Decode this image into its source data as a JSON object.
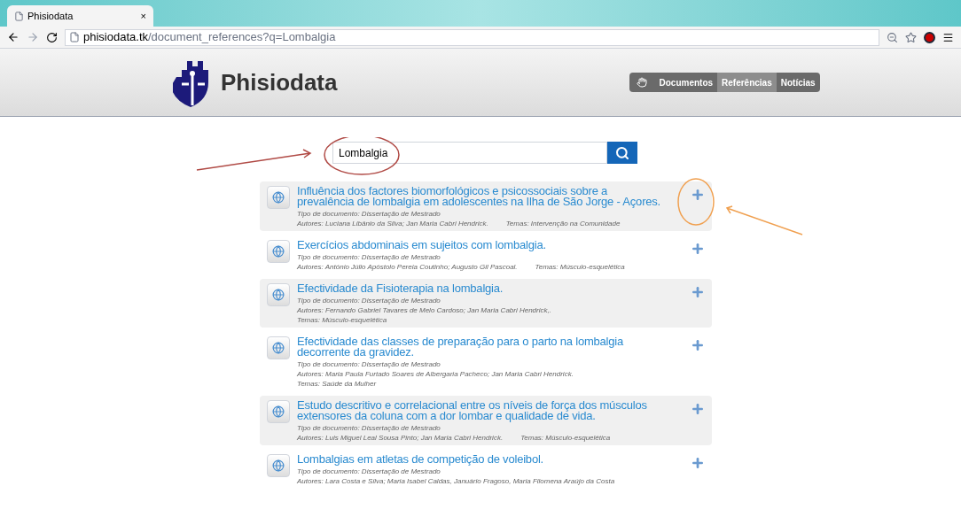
{
  "browser": {
    "tab_title": "Phisiodata",
    "tab_close": "×",
    "url_host": "phisiodata.tk",
    "url_path": "/document_references?q=Lombalgia"
  },
  "site": {
    "name": "Phisiodata",
    "nav": [
      {
        "label": "Documentos",
        "selected": false
      },
      {
        "label": "Referências",
        "selected": true
      },
      {
        "label": "Notícias",
        "selected": false
      }
    ]
  },
  "search": {
    "value": "Lombalgia"
  },
  "results": [
    {
      "title": "Influência dos factores biomorfológicos e psicossociais sobre a prevalência de lombalgia em adolescentes na Ilha de São Jorge - Açores.",
      "meta_lines": [
        [
          "Tipo de documento: Dissertação de Mestrado"
        ],
        [
          "Autores: Luciana Libânio da Silva; Jan Maria Cabri Hendrick.",
          "Temas: Intervenção na Comunidade"
        ]
      ]
    },
    {
      "title": "Exercícios abdominais em sujeitos com lombalgia.",
      "meta_lines": [
        [
          "Tipo de documento: Dissertação de Mestrado"
        ],
        [
          "Autores: António Júlio Apóstolo Pereia Coutinho; Augusto Gil Pascoal.",
          "Temas: Músculo-esquelética"
        ]
      ]
    },
    {
      "title": "Efectividade da Fisioterapia na lombalgia.",
      "meta_lines": [
        [
          "Tipo de documento: Dissertação de Mestrado"
        ],
        [
          "Autores: Fernando Gabriel Tavares de Melo Cardoso; Jan Maria Cabri Hendrick,."
        ],
        [
          "Temas: Músculo-esquelética"
        ]
      ]
    },
    {
      "title": "Efectividade das classes de preparação para o parto na lombalgia decorrente da gravidez.",
      "meta_lines": [
        [
          "Tipo de documento: Dissertação de Mestrado"
        ],
        [
          "Autores: Maria Paula Furtado Soares de Albergaria Pacheco; Jan Maria Cabri Hendrick."
        ],
        [
          "Temas: Saúde da Mulher"
        ]
      ]
    },
    {
      "title": "Estudo descritivo e correlacional entre os níveis de força dos músculos extensores da coluna com a dor lombar e qualidade de vida.",
      "meta_lines": [
        [
          "Tipo de documento: Dissertação de Mestrado"
        ],
        [
          "Autores: Luis Miguel Leal Sousa Pinto; Jan Maria Cabri Hendrick.",
          "Temas: Músculo-esquelética"
        ]
      ]
    },
    {
      "title": "Lombalgias em atletas de competição de voleibol.",
      "meta_lines": [
        [
          "Tipo de documento: Dissertação de Mestrado"
        ],
        [
          "Autores: Lara Costa e Silva; Maria Isabel Caldas, Januário Fragoso, Maria Filomena Araújo da Costa"
        ]
      ]
    }
  ]
}
